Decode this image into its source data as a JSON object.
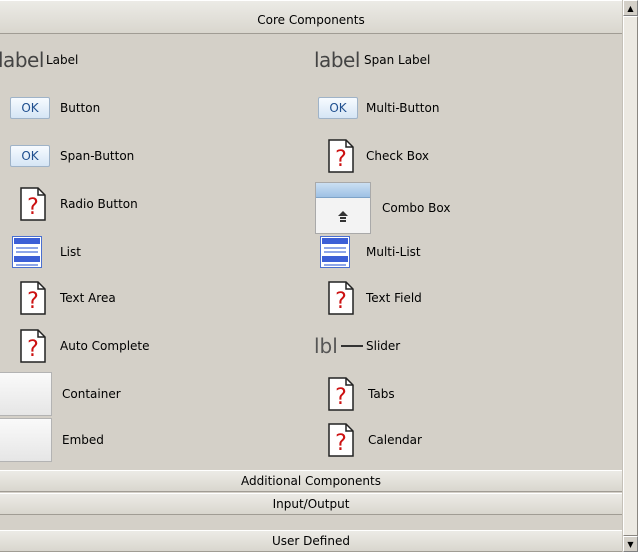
{
  "sections": {
    "core": "Core Components",
    "additional": "Additional Components",
    "io": "Input/Output",
    "user": "User Defined"
  },
  "components": {
    "label": "Label",
    "span_label": "Span Label",
    "button": "Button",
    "multi_button": "Multi-Button",
    "span_button": "Span-Button",
    "check_box": "Check Box",
    "radio_button": "Radio Button",
    "combo_box": "Combo Box",
    "list": "List",
    "multi_list": "Multi-List",
    "text_area": "Text Area",
    "text_field": "Text Field",
    "auto_complete": "Auto Complete",
    "slider": "Slider",
    "container": "Container",
    "tabs": "Tabs",
    "embed": "Embed",
    "calendar": "Calendar"
  },
  "icons": {
    "label_text": "label",
    "ok_text": "OK",
    "slider_text": "lbl"
  },
  "colors": {
    "panel": "#d4d0c8",
    "missing_icon": "#cc1111"
  }
}
